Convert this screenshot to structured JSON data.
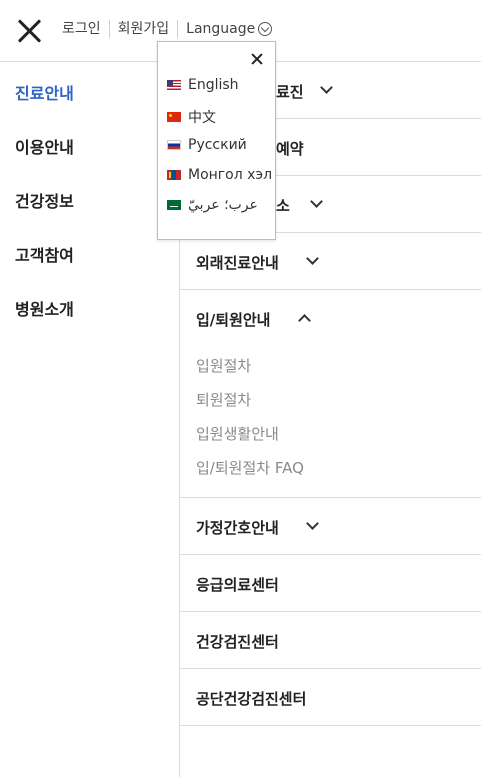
{
  "header": {
    "login": "로그인",
    "signup": "회원가입",
    "language": "Language"
  },
  "leftnav": {
    "items": [
      {
        "label": "진료안내",
        "active": true
      },
      {
        "label": "이용안내"
      },
      {
        "label": "건강정보"
      },
      {
        "label": "고객참여"
      },
      {
        "label": "병원소개"
      }
    ]
  },
  "rightnav": {
    "sections": [
      {
        "label": "진료과/의료진",
        "visible_label": "료진",
        "expanded": false
      },
      {
        "label": "진료예약",
        "visible_label": "예약",
        "expanded": false
      },
      {
        "label": "진료절차/장소",
        "visible_label": "소",
        "expanded": false
      },
      {
        "label": "외래진료안내",
        "expanded": false
      },
      {
        "label": "입/퇴원안내",
        "expanded": true,
        "children": [
          "입원절차",
          "퇴원절차",
          "입원생활안내",
          "입/퇴원절차 FAQ"
        ]
      },
      {
        "label": "가정간호안내",
        "expanded": false
      },
      {
        "label": "응급의료센터"
      },
      {
        "label": "건강검진센터"
      },
      {
        "label": "공단건강검진센터"
      }
    ]
  },
  "language_dropdown": {
    "options": [
      {
        "label": "English",
        "flag": "flag-us-icon"
      },
      {
        "label": "中文",
        "flag": "flag-cn-icon"
      },
      {
        "label": "Русский",
        "flag": "flag-ru-icon"
      },
      {
        "label": "Монгол хэл",
        "flag": "flag-mn-icon"
      },
      {
        "label": "عرب؛ عربيّ",
        "flag": "flag-sa-icon"
      }
    ]
  },
  "colors": {
    "active": "#2b63c6",
    "divider": "#dcdcdc",
    "submenu_text": "#8a8a8a"
  }
}
